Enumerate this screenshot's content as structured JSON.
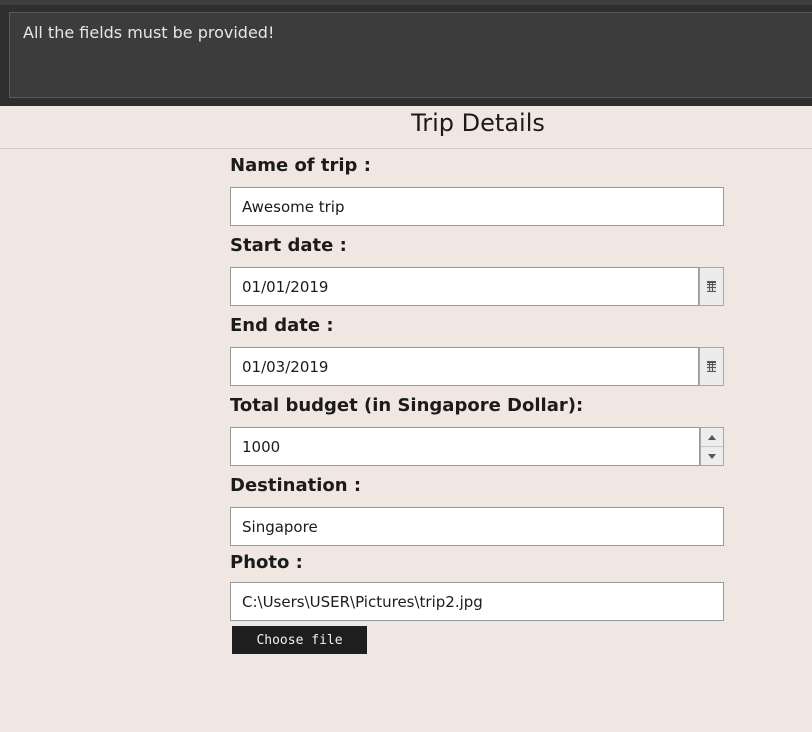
{
  "message": {
    "text": "All the fields must be provided!"
  },
  "form": {
    "title": "Trip Details",
    "name": {
      "label": "Name of trip :",
      "value": "Awesome trip"
    },
    "start_date": {
      "label": "Start date :",
      "value": "01/01/2019",
      "icon": "calendar-icon"
    },
    "end_date": {
      "label": "End date :",
      "value": "01/03/2019",
      "icon": "calendar-icon"
    },
    "budget": {
      "label": "Total budget (in Singapore Dollar):",
      "value": "1000"
    },
    "destination": {
      "label": "Destination :",
      "value": "Singapore"
    },
    "photo": {
      "label": "Photo :",
      "value": "C:\\Users\\USER\\Pictures\\trip2.jpg",
      "button_label": "Choose file"
    }
  },
  "colors": {
    "background": "#f0e6e2",
    "message_bar": "#2f2f2f",
    "button": "#1e1e1e"
  }
}
